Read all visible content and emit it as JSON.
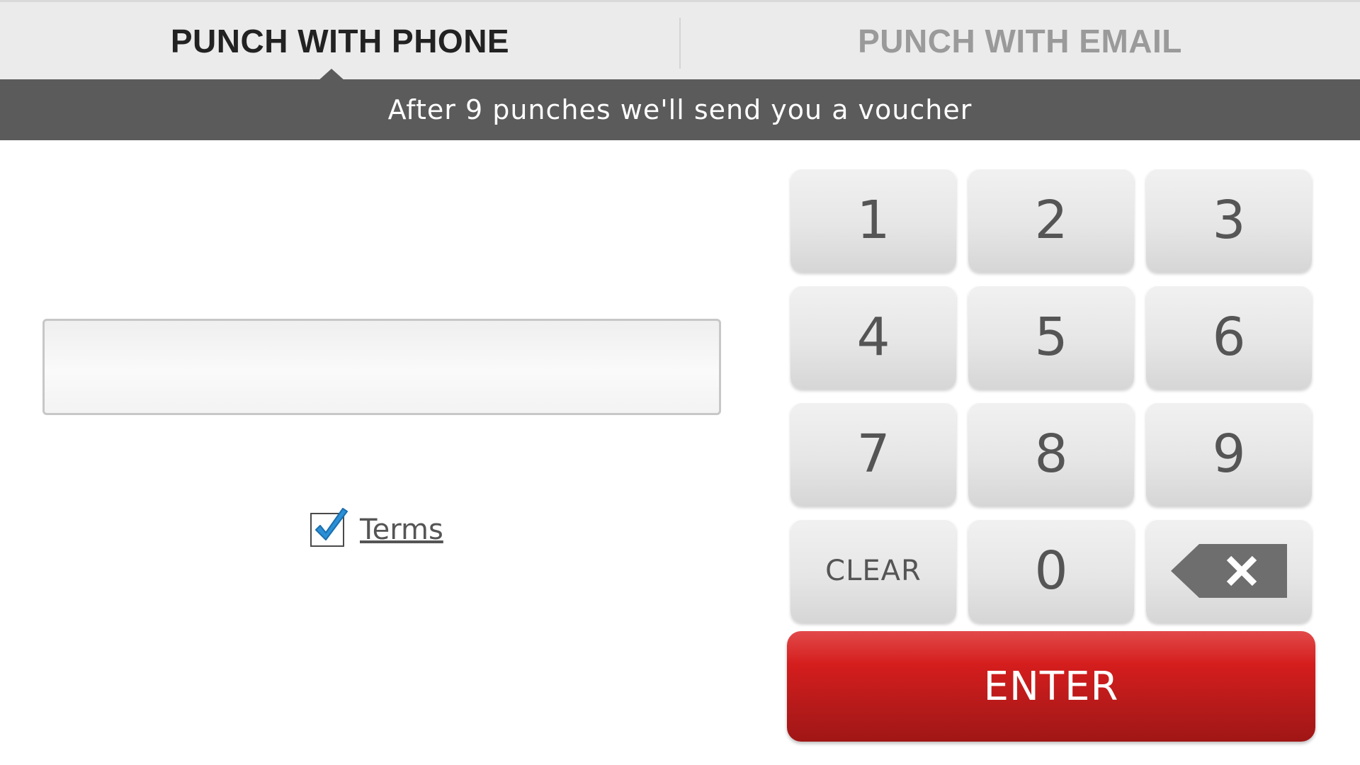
{
  "tabs": [
    {
      "label": "PUNCH WITH PHONE",
      "active": true
    },
    {
      "label": "PUNCH WITH EMAIL",
      "active": false
    }
  ],
  "banner": {
    "text": "After 9 punches we'll send you a voucher"
  },
  "phone_input": {
    "value": "",
    "placeholder": ""
  },
  "terms": {
    "label": "Terms",
    "checked": true
  },
  "keypad": {
    "keys": [
      "1",
      "2",
      "3",
      "4",
      "5",
      "6",
      "7",
      "8",
      "9",
      "CLEAR",
      "0"
    ],
    "backspace_icon": "backspace-icon"
  },
  "enter": {
    "label": "ENTER"
  },
  "colors": {
    "banner_bg": "#5b5b5b",
    "enter_red": "#d51d1d",
    "checkmark_blue": "#2a8fd6",
    "tab_active_text": "#222222",
    "tab_inactive_text": "#9a9a9a"
  }
}
